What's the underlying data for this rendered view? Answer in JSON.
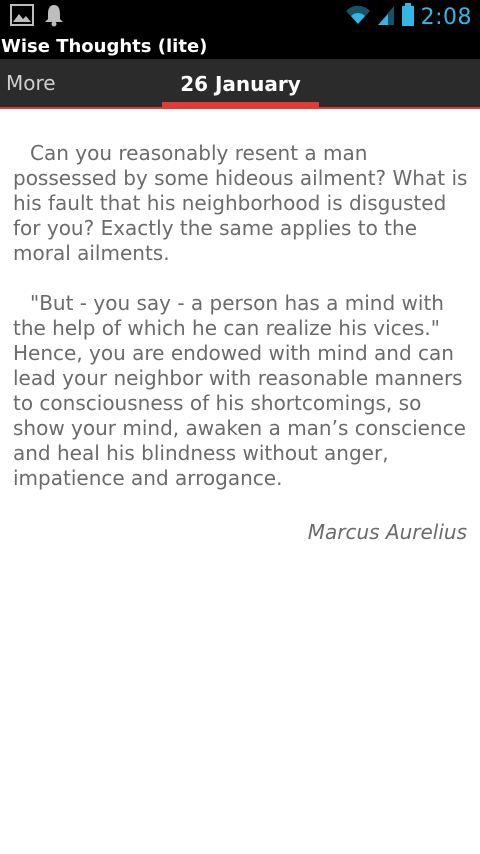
{
  "status_bar": {
    "time": "2:08",
    "icons": [
      "image-icon",
      "notification-bell-icon",
      "wifi-icon",
      "signal-icon",
      "battery-icon"
    ],
    "clock_color": "#33b5e5"
  },
  "app": {
    "title": "Wise Thoughts (lite)"
  },
  "tabs": {
    "more_label": "More",
    "current_label": "26 January",
    "accent_color": "#e53935"
  },
  "quote": {
    "paragraph1": "Can you reasonably resent a man possessed by some hideous ailment? What is his fault that his neighborhood is disgusted for you? Exactly the same applies to the moral ailments.",
    "paragraph2": "\"But - you say - a person has a mind with the help of which he can realize his vices.\" Hence, you are endowed with mind and can lead your neighbor with reasonable manners to consciousness of his shortcomings, so show your mind, awaken a man’s conscience and heal his blindness without anger, impatience and arrogance.",
    "author": "Marcus Aurelius"
  }
}
